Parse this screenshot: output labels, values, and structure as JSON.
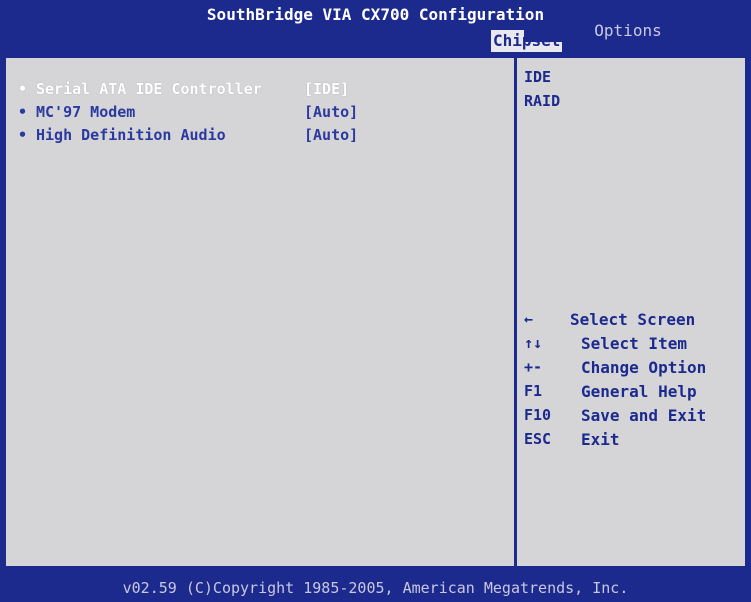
{
  "title": "SouthBridge VIA CX700 Configuration",
  "tab": "Chipset",
  "settings": [
    {
      "bullet": "•",
      "label": "Serial ATA IDE Controller",
      "value": "[IDE]"
    },
    {
      "bullet": "•",
      "label": "MC'97 Modem",
      "value": "[Auto]"
    },
    {
      "bullet": "•",
      "label": "High Definition Audio",
      "value": "[Auto]"
    }
  ],
  "options_header": "Options",
  "options": [
    "IDE",
    "RAID"
  ],
  "help": [
    {
      "key": "←",
      "desc": "Select Screen"
    },
    {
      "key": "↑↓",
      "desc": "Select Item"
    },
    {
      "key": "+-",
      "desc": "Change Option"
    },
    {
      "key": "F1",
      "desc": "General Help"
    },
    {
      "key": "F10",
      "desc": "Save and Exit"
    },
    {
      "key": "ESC",
      "desc": "Exit"
    }
  ],
  "footer": "v02.59 (C)Copyright 1985-2005, American Megatrends, Inc.",
  "colors": {
    "bios_blue": "#1c2a8e",
    "panel_gray": "#d5d5d8",
    "selected_text": "#ffffff"
  }
}
